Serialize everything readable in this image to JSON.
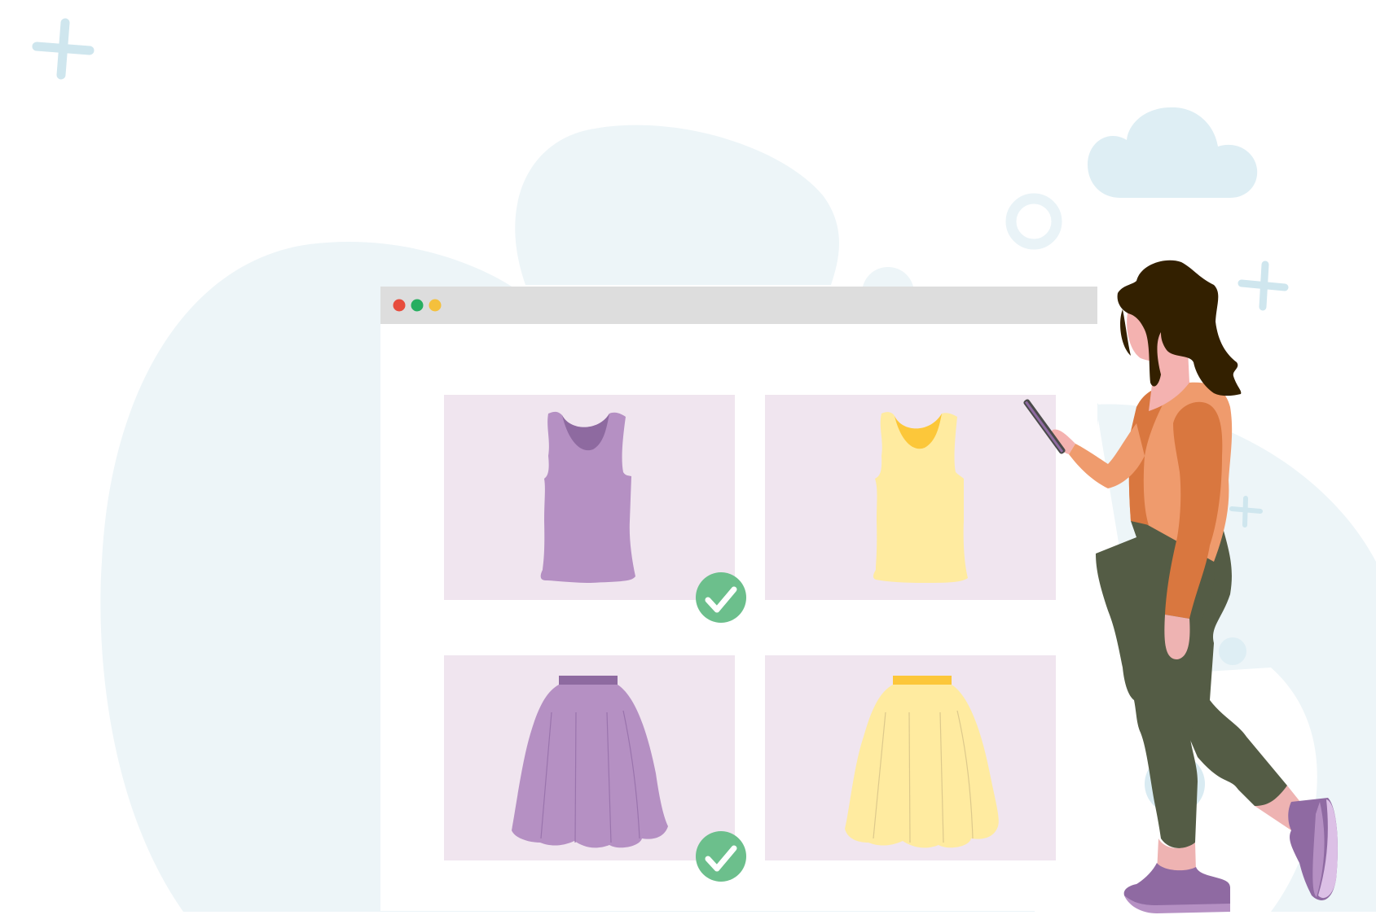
{
  "scene": {
    "description_role": "illustration",
    "window_controls": [
      "close",
      "minimize",
      "maximize"
    ],
    "products": [
      {
        "name": "tank-top",
        "color": "purple",
        "selected": true
      },
      {
        "name": "tank-top",
        "color": "yellow",
        "selected": false
      },
      {
        "name": "skirt",
        "color": "purple",
        "selected": true
      },
      {
        "name": "skirt",
        "color": "yellow",
        "selected": false
      }
    ]
  },
  "colors": {
    "background_blob": "#edf5f8",
    "window_bar": "#dddddd",
    "window_body": "#ffffff",
    "card_bg": "#f0e5ef",
    "purple_item": "#b590c3",
    "purple_dark": "#8e6aa0",
    "yellow_item": "#ffeba0",
    "yellow_dark": "#fcc73a",
    "check_green": "#6cbf8c",
    "dot_red": "#e74c3c",
    "dot_green": "#27ae60",
    "dot_yellow": "#f4c03c",
    "cloud": "#deeef4",
    "sparkle": "#cfe6ee",
    "hair": "#332000",
    "skin": "#f4b2b0",
    "sweater": "#ef9b6d",
    "sweater_dark": "#d9773f",
    "pants": "#545c45",
    "shoes": "#8f6aa2"
  },
  "icons": [
    "plus-sparkle-icon",
    "cloud-icon",
    "ring-icon",
    "checkmark-icon",
    "phone-icon"
  ]
}
